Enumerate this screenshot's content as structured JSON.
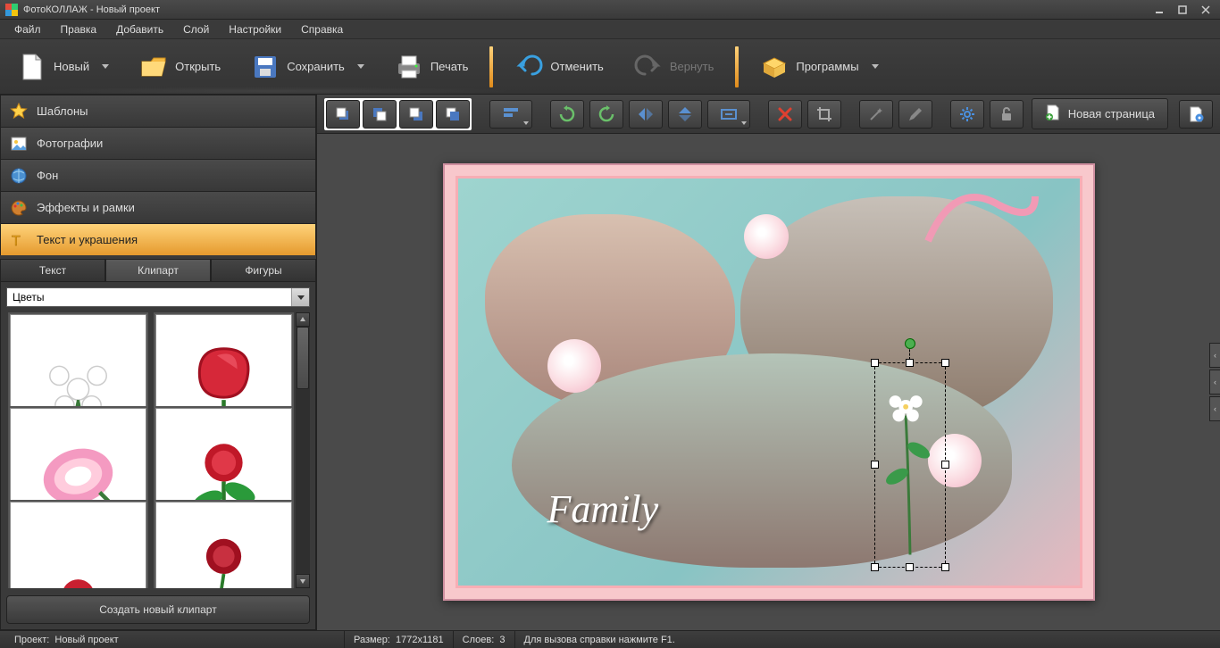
{
  "titlebar": {
    "title": "ФотоКОЛЛАЖ - Новый проект"
  },
  "menu": {
    "file": "Файл",
    "edit": "Правка",
    "add": "Добавить",
    "layer": "Слой",
    "settings": "Настройки",
    "help": "Справка"
  },
  "toolbar": {
    "new": "Новый",
    "open": "Открыть",
    "save": "Сохранить",
    "print": "Печать",
    "undo": "Отменить",
    "redo": "Вернуть",
    "programs": "Программы"
  },
  "sidebar": {
    "templates": "Шаблоны",
    "photos": "Фотографии",
    "background": "Фон",
    "effects": "Эффекты и рамки",
    "text_decor": "Текст и украшения"
  },
  "subtabs": {
    "text": "Текст",
    "clipart": "Клипарт",
    "shapes": "Фигуры"
  },
  "clipart": {
    "category": "Цветы",
    "create_btn": "Создать новый клипарт"
  },
  "canvas": {
    "family_text": "Family",
    "new_page": "Новая страница"
  },
  "status": {
    "project_label": "Проект:",
    "project_name": "Новый проект",
    "size_label": "Размер:",
    "size_value": "1772x1181",
    "layers_label": "Слоев:",
    "layers_value": "3",
    "help_hint": "Для вызова справки нажмите F1."
  }
}
